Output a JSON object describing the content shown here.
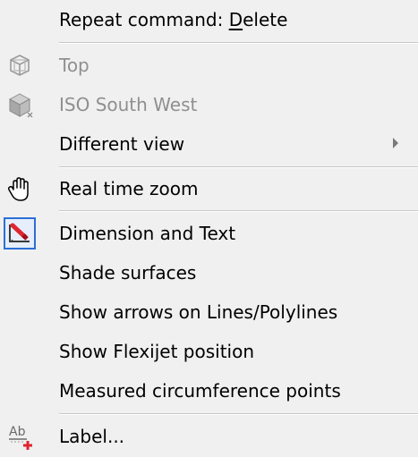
{
  "menu": {
    "items": [
      {
        "label_pre": "Repeat command: ",
        "label_accel": "D",
        "label_post": "elete"
      },
      {
        "label": "Top",
        "icon": "top-view-icon",
        "disabled": true
      },
      {
        "label": "ISO South West",
        "icon": "iso-south-west-icon",
        "disabled": true
      },
      {
        "label": "Different view",
        "submenu": true
      },
      {
        "label": "Real time zoom",
        "icon": "hand-icon"
      },
      {
        "label": "Dimension and Text",
        "icon": "dimension-text-icon",
        "checked": true
      },
      {
        "label": "Shade surfaces"
      },
      {
        "label": "Show arrows on Lines/Polylines"
      },
      {
        "label": "Show Flexijet position"
      },
      {
        "label": "Measured circumference points"
      },
      {
        "label": "Label...",
        "icon": "add-label-icon"
      }
    ]
  },
  "colors": {
    "background": "#f0f0f0",
    "disabled_text": "#8f8f8f",
    "check_frame": "#2b6fd6",
    "accent_red": "#e0252f"
  }
}
